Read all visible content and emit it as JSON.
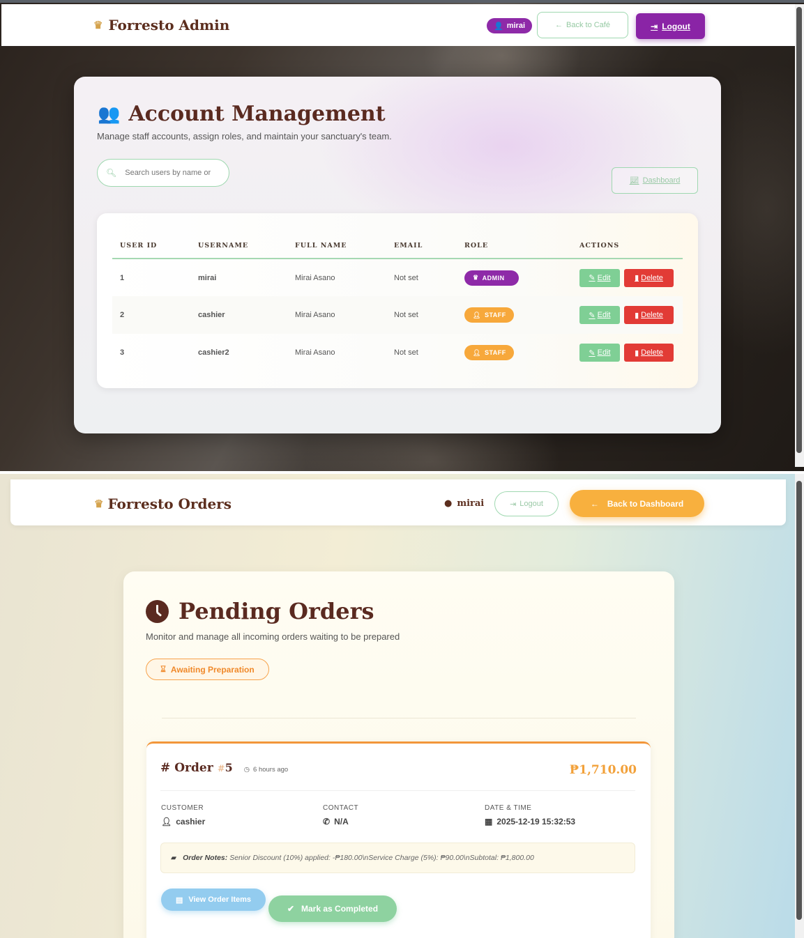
{
  "admin": {
    "nav": {
      "brand": "Forresto Admin",
      "user_pill": "mirai",
      "back_label": "Back to Café",
      "logout_label": "Logout"
    },
    "title": "Account Management",
    "subtitle": "Manage staff accounts, assign roles, and maintain your sanctuary's team.",
    "search": {
      "placeholder": "Search users by name or"
    },
    "dashboard_label": "Dashboard",
    "table": {
      "headers": [
        "USER ID",
        "USERNAME",
        "FULL NAME",
        "EMAIL",
        "ROLE",
        "ACTIONS"
      ],
      "rows": [
        {
          "id": "1",
          "username": "mirai",
          "full_name": "Mirai Asano",
          "email": "Not set",
          "role": "ADMIN",
          "edit": "Edit",
          "delete": "Delete"
        },
        {
          "id": "2",
          "username": "cashier",
          "full_name": "Mirai Asano",
          "email": "Not set",
          "role": "STAFF",
          "edit": "Edit",
          "delete": "Delete"
        },
        {
          "id": "3",
          "username": "cashier2",
          "full_name": "Mirai Asano",
          "email": "Not set",
          "role": "STAFF",
          "edit": "Edit",
          "delete": "Delete"
        }
      ]
    },
    "colors": {
      "purple": "#8e2aa8",
      "green": "#7fcf95",
      "red": "#e23b36",
      "orange": "#f7a83b"
    }
  },
  "orders": {
    "nav": {
      "brand": "Forresto Orders",
      "user": "mirai",
      "logout_label": "Logout",
      "back_label": "Back to Dashboard"
    },
    "title": "Pending Orders",
    "subtitle": "Monitor and manage all incoming orders waiting to be prepared",
    "status_badge": "Awaiting Preparation",
    "order": {
      "title": "Order",
      "hash": "#",
      "number": "5",
      "ago": "6 hours ago",
      "total": "₱1,710.00",
      "customer_label": "CUSTOMER",
      "customer": "cashier",
      "contact_label": "CONTACT",
      "contact": "N/A",
      "datetime_label": "DATE & TIME",
      "datetime": "2025-12-19 15:32:53",
      "notes_label": "Order Notes:",
      "notes": "Senior Discount (10%) applied: -₱180.00\\nService Charge (5%): ₱90.00\\nSubtotal: ₱1,800.00",
      "view_items_label": "View Order Items",
      "complete_label": "Mark as Completed"
    },
    "colors": {
      "accent": "#f8b03e",
      "brown": "#5a2a20",
      "blue": "#93ccef",
      "green": "#8ed2a0"
    }
  }
}
